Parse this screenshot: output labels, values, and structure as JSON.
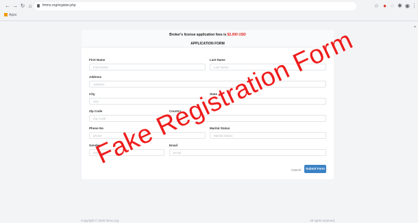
{
  "browser": {
    "url": "fmmo.org/register.php",
    "bookmarks_label": "Apps"
  },
  "banner": {
    "fee_text": "Broker's license application fees is",
    "fee_amount": "$2,000 USD",
    "form_title": "APPLICATION FORM"
  },
  "form": {
    "first_name": {
      "label": "First Name",
      "placeholder": "First Name"
    },
    "last_name": {
      "label": "Last Name",
      "placeholder": "Last Name"
    },
    "address": {
      "label": "Address",
      "placeholder": "Address"
    },
    "city": {
      "label": "City",
      "placeholder": "City"
    },
    "state": {
      "label": "State",
      "placeholder": ""
    },
    "zip": {
      "label": "Zip Code",
      "placeholder": "Zip Code"
    },
    "country": {
      "label": "Country",
      "placeholder": ""
    },
    "phone": {
      "label": "Phone No",
      "placeholder": "phone"
    },
    "marital": {
      "label": "Marital Status",
      "placeholder": "Marital Status"
    },
    "gender": {
      "label": "Gender",
      "placeholder": "Gender"
    },
    "email": {
      "label": "Email",
      "placeholder": "Email"
    },
    "cancel_label": "Cancel",
    "submit_label": "Submit Form"
  },
  "footer": {
    "copyright": "Copyright © 2020 fmmo.org",
    "rights": "All rights reserved."
  },
  "watermark": "Fake Registration Form"
}
